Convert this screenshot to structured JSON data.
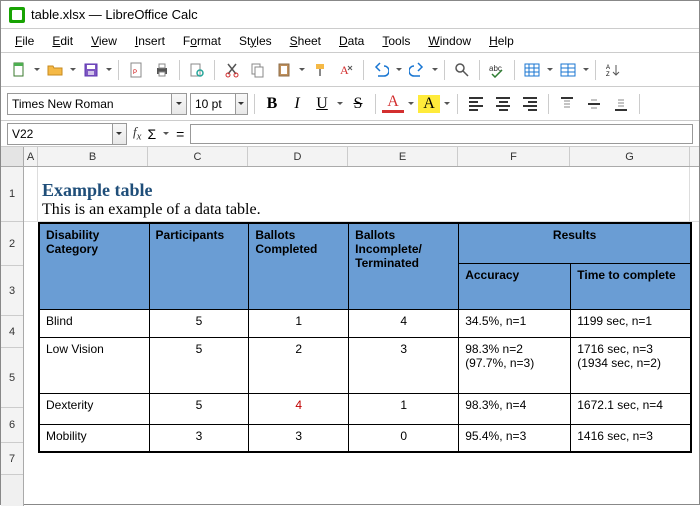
{
  "window": {
    "title": "table.xlsx — LibreOffice Calc"
  },
  "menu": {
    "file": "File",
    "edit": "Edit",
    "view": "View",
    "insert": "Insert",
    "format": "Format",
    "styles": "Styles",
    "sheet": "Sheet",
    "data": "Data",
    "tools": "Tools",
    "window": "Window",
    "help": "Help"
  },
  "format": {
    "font": "Times New Roman",
    "size": "10 pt",
    "bold": "B",
    "italic": "I",
    "underline": "U",
    "strike": "S",
    "fontcolor": "A",
    "highlight": "A"
  },
  "namebox": {
    "cell": "V22",
    "formula": ""
  },
  "cols": {
    "A": "A",
    "B": "B",
    "C": "C",
    "D": "D",
    "E": "E",
    "F": "F",
    "G": "G"
  },
  "rows": {
    "r1": "1",
    "r2": "2",
    "r3": "3",
    "r4": "4",
    "r5": "5",
    "r6": "6",
    "r7": "7"
  },
  "content": {
    "caption": "Example table",
    "description": "This is an example of a data table."
  },
  "table": {
    "headers": {
      "disability": "Disability Category",
      "participants": "Participants",
      "ballots_completed": "Ballots Completed",
      "ballots_incomplete": "Ballots Incomplete/\nTerminated",
      "results": "Results",
      "accuracy": "Accuracy",
      "time": "Time to complete"
    },
    "rows": [
      {
        "category": "Blind",
        "participants": "5",
        "completed": "1",
        "incomplete": "4",
        "accuracy": "34.5%, n=1",
        "time": "1199 sec, n=1"
      },
      {
        "category": "Low Vision",
        "participants": "5",
        "completed": "2",
        "incomplete": "3",
        "accuracy": "98.3% n=2 (97.7%, n=3)",
        "time": "1716 sec, n=3 (1934 sec, n=2)"
      },
      {
        "category": "Dexterity",
        "participants": "5",
        "completed": "4",
        "incomplete": "1",
        "accuracy": "98.3%, n=4",
        "time": "1672.1 sec, n=4"
      },
      {
        "category": "Mobility",
        "participants": "3",
        "completed": "3",
        "incomplete": "0",
        "accuracy": "95.4%, n=3",
        "time": "1416 sec, n=3"
      }
    ]
  },
  "chart_data": {
    "type": "table",
    "title": "Example table",
    "columns": [
      "Disability Category",
      "Participants",
      "Ballots Completed",
      "Ballots Incomplete/Terminated",
      "Accuracy",
      "Time to complete"
    ],
    "data": [
      [
        "Blind",
        5,
        1,
        4,
        "34.5%, n=1",
        "1199 sec, n=1"
      ],
      [
        "Low Vision",
        5,
        2,
        3,
        "98.3% n=2 (97.7%, n=3)",
        "1716 sec, n=3 (1934 sec, n=2)"
      ],
      [
        "Dexterity",
        5,
        4,
        1,
        "98.3%, n=4",
        "1672.1 sec, n=4"
      ],
      [
        "Mobility",
        3,
        3,
        0,
        "95.4%, n=3",
        "1416 sec, n=3"
      ]
    ]
  }
}
